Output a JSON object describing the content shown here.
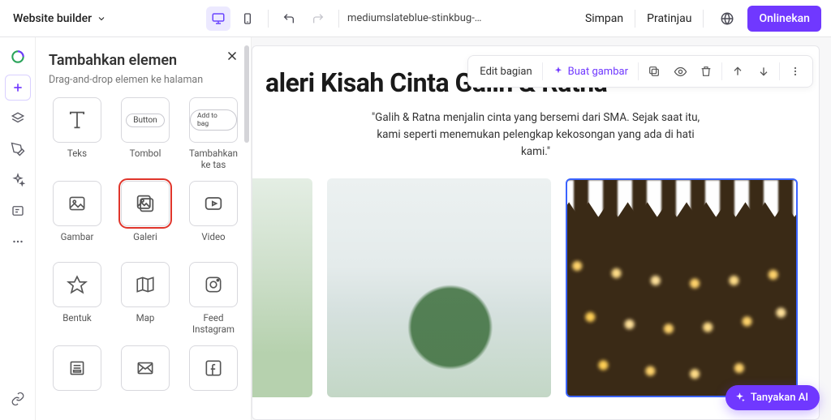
{
  "topbar": {
    "brand": "Website builder",
    "project_name": "mediumslateblue-stinkbug-3...",
    "save": "Simpan",
    "preview": "Pratinjau",
    "publish": "Onlinekan"
  },
  "panel": {
    "title": "Tambahkan elemen",
    "subtitle": "Drag-and-drop elemen ke halaman",
    "tiles": [
      {
        "id": "teks",
        "label": "Teks"
      },
      {
        "id": "tombol",
        "label": "Tombol",
        "pill": "Button"
      },
      {
        "id": "tambahtas",
        "label": "Tambahkan ke tas",
        "pill": "Add to bag"
      },
      {
        "id": "gambar",
        "label": "Gambar"
      },
      {
        "id": "galeri",
        "label": "Galeri"
      },
      {
        "id": "video",
        "label": "Video"
      },
      {
        "id": "bentuk",
        "label": "Bentuk"
      },
      {
        "id": "map",
        "label": "Map"
      },
      {
        "id": "feed",
        "label": "Feed Instagram"
      },
      {
        "id": "form",
        "label": ""
      },
      {
        "id": "mail",
        "label": ""
      },
      {
        "id": "fb",
        "label": ""
      }
    ]
  },
  "canvas": {
    "toolbar": {
      "edit_section": "Edit bagian",
      "gen_image": "Buat gambar"
    },
    "title": "aleri Kisah Cinta Galih & Ratna",
    "quote": "\"Galih & Ratna menjalin cinta yang bersemi dari SMA. Sejak saat itu, kami seperti menemukan pelengkap kekosongan yang ada di hati kami.\""
  },
  "fab": {
    "ask_ai": "Tanyakan AI"
  }
}
